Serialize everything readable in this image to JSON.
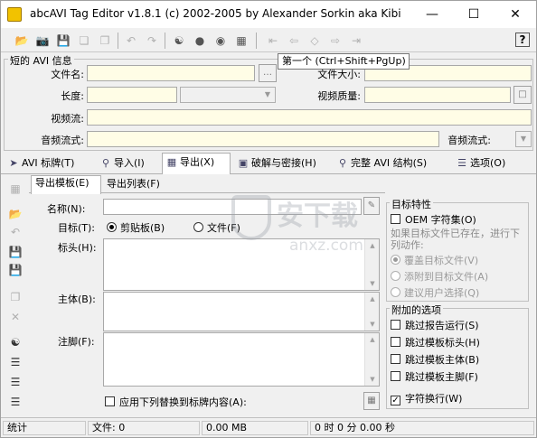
{
  "window": {
    "title": "abcAVI Tag Editor v1.8.1 (c) 2002-2005 by Alexander Sorkin aka Kibi"
  },
  "tooltip": "第一个 (Ctrl+Shift+PgUp)",
  "avi_info": {
    "group_title": "短的 AVI 信息",
    "filename_label": "文件名:",
    "filesize_label": "文件大小:",
    "length_label": "长度:",
    "video_quality_label": "视频质量:",
    "video_stream_label": "视频流:",
    "audio_stream_label": "音频流式:",
    "audio_stream_label2": "音频流式:"
  },
  "tabs": [
    {
      "label": "AVI 标牌(T)",
      "icon": "tag-icon"
    },
    {
      "label": "导入(I)",
      "icon": "magnifier-icon"
    },
    {
      "label": "导出(X)",
      "icon": "table-icon"
    },
    {
      "label": "破解与密接(H)",
      "icon": "crack-icon"
    },
    {
      "label": "完整 AVI 结构(S)",
      "icon": "search-icon"
    },
    {
      "label": "选项(O)",
      "icon": "options-icon"
    }
  ],
  "subtabs": [
    "导出模板(E)",
    "导出列表(F)"
  ],
  "export": {
    "name_label": "名称(N):",
    "target_label": "目标(T):",
    "clipboard_option": "剪贴板(B)",
    "file_option": "文件(F)",
    "header_label": "标头(H):",
    "body_label": "主体(B):",
    "footer_label": "注脚(F):",
    "apply_replace_label": "应用下列替换到标牌内容(A):"
  },
  "target_props": {
    "group_title": "目标特性",
    "oem_charset": "OEM 字符集(O)",
    "exists_description": "如果目标文件已存在，进行下列动作:",
    "overwrite_option": "覆盖目标文件(V)",
    "append_option": "添附到目标文件(A)",
    "ask_option": "建议用户选择(Q)"
  },
  "extra_options": {
    "group_title": "附加的选项",
    "skip_report_run": "跳过报告运行(S)",
    "skip_header": "跳过模板标头(H)",
    "skip_body": "跳过模板主体(B)",
    "skip_footer": "跳过模板主脚(F)",
    "word_wrap": "字符换行(W)",
    "word_wrap_checked": true
  },
  "status": {
    "stats_label": "统计",
    "files_label": "文件: 0",
    "size_label": "0.00 MB",
    "time_label": "0 时 0 分 0.00 秒"
  },
  "watermark": {
    "text": "安下载",
    "sub": "anxz.com"
  }
}
